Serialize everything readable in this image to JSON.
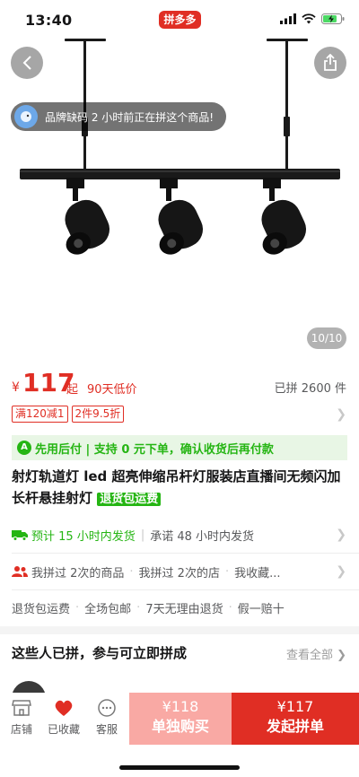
{
  "status": {
    "time": "13:40",
    "app_logo": "拼多多"
  },
  "gallery": {
    "toast_text": "品牌缺码 2 小时前正在拼这个商品!",
    "counter": "10/10",
    "icons": [
      "back-arrow-icon",
      "share-icon",
      "track-light-product-image"
    ]
  },
  "price": {
    "symbol": "¥",
    "value": "117",
    "suffix": "起",
    "tag": "90天低价",
    "sold": "已拼 2600 件"
  },
  "promos": [
    "满120减1",
    "2件9.5折"
  ],
  "pay_banner": "先用后付 | 支持 0 元下单，确认收货后再付款",
  "title": {
    "text": "射灯轨道灯 led 超亮伸缩吊杆灯服装店直播间无频闪加长杆悬挂射灯",
    "badge": "退货包运费"
  },
  "shipping": {
    "main": "预计 15 小时内发货",
    "promise": "承诺 48 小时内发货"
  },
  "history": [
    "我拼过 2次的商品",
    "我拼过 2次的店",
    "我收藏..."
  ],
  "services": [
    "退货包运费",
    "全场包邮",
    "7天无理由退货",
    "假一赔十"
  ],
  "group": {
    "title": "这些人已拼，参与可立即拼成",
    "view_all": "查看全部"
  },
  "bottom": {
    "store_label": "店铺",
    "fav_label": "已收藏",
    "service_label": "客服",
    "solo_price": "¥118",
    "solo_label": "单独购买",
    "group_price": "¥117",
    "group_label": "发起拼单"
  },
  "colors": {
    "brand_red": "#e02e24",
    "pay_green": "#25b513"
  }
}
